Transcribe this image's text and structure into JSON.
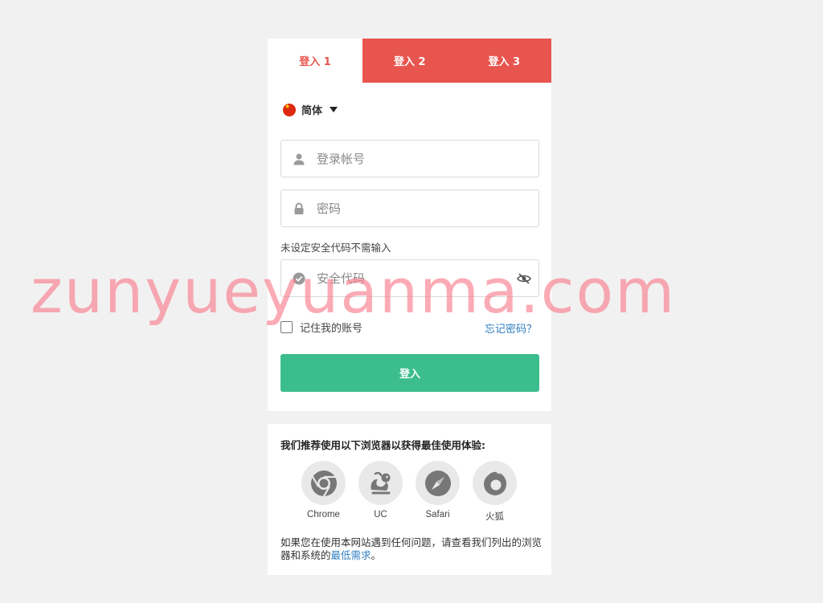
{
  "tabs": [
    {
      "label": "登入 1",
      "active": true
    },
    {
      "label": "登入 2",
      "active": false
    },
    {
      "label": "登入 3",
      "active": false
    }
  ],
  "language": {
    "label": "简体",
    "icon": "china-flag-icon"
  },
  "form": {
    "account_placeholder": "登录帐号",
    "password_placeholder": "密码",
    "code_hint": "未设定安全代码不需输入",
    "code_placeholder": "安全代码",
    "remember_label": "记住我的账号",
    "remember_checked": false,
    "forgot_label": "忘记密码？",
    "submit_label": "登入"
  },
  "browsers_panel": {
    "title": "我们推荐使用以下浏览器以获得最佳使用体验:",
    "browsers": [
      {
        "name": "Chrome",
        "icon": "chrome-icon"
      },
      {
        "name": "UC",
        "icon": "uc-browser-icon"
      },
      {
        "name": "Safari",
        "icon": "safari-icon"
      },
      {
        "name": "火狐",
        "icon": "firefox-icon"
      }
    ],
    "note_text": "如果您在使用本网站遇到任何问题，请查看我们列出的浏览器和系统的",
    "note_link": "最低需求",
    "note_end": "。"
  },
  "watermark": "zunyueyuanma.com",
  "colors": {
    "accent_red": "#e8554e",
    "submit_green": "#3bbd8e",
    "link_blue": "#2f7ec1",
    "background": "#f1f1f1"
  }
}
